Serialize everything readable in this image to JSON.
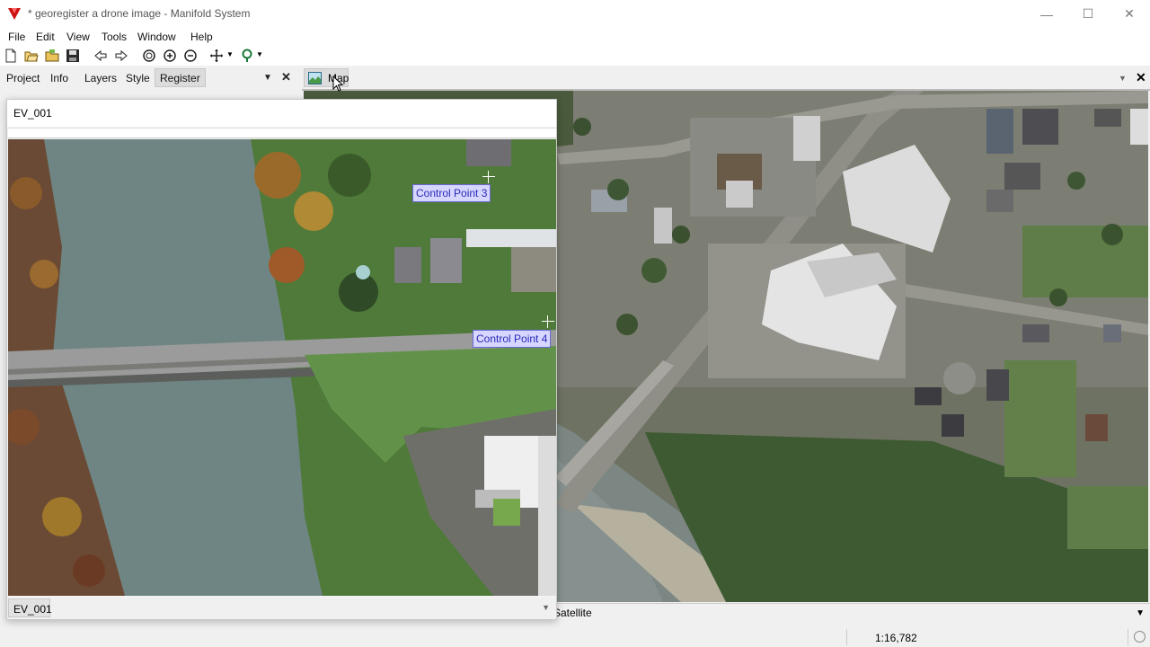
{
  "window": {
    "title": "* georegister a drone image - Manifold System",
    "minimize": "—",
    "maximize": "☐",
    "close": "✕"
  },
  "menu": [
    "File",
    "Edit",
    "View",
    "Tools",
    "Window",
    "Help"
  ],
  "toolbar_icons": [
    "new-icon",
    "open-icon",
    "open-folder-icon",
    "save-icon",
    "back-icon",
    "forward-icon",
    "zoom-extent-icon",
    "zoom-in-icon",
    "zoom-out-icon",
    "pan-icon",
    "locate-icon"
  ],
  "panel": {
    "tabs": [
      "Project",
      "Info",
      "Layers",
      "Style",
      "Register"
    ],
    "active_tab": "Register",
    "dropdown": "▼",
    "close": "✕"
  },
  "map_window": {
    "tab_label": "Map",
    "dropdown": "▼",
    "close": "✕",
    "layer_tab": "Satellite",
    "layer_dropdown": "▼"
  },
  "register_window": {
    "title": "EV_001",
    "footer_tab": "EV_001",
    "footer_dropdown": "▼",
    "control_points": [
      {
        "label": "Control Point 3"
      },
      {
        "label": "Control Point 4"
      }
    ]
  },
  "status": {
    "scale": "1:16,782"
  },
  "colors": {
    "control_point_bg": "#d6d6ff",
    "control_point_border": "#6a6ad8",
    "control_point_text": "#2a2ab8",
    "app_logo": "#cc1111"
  }
}
